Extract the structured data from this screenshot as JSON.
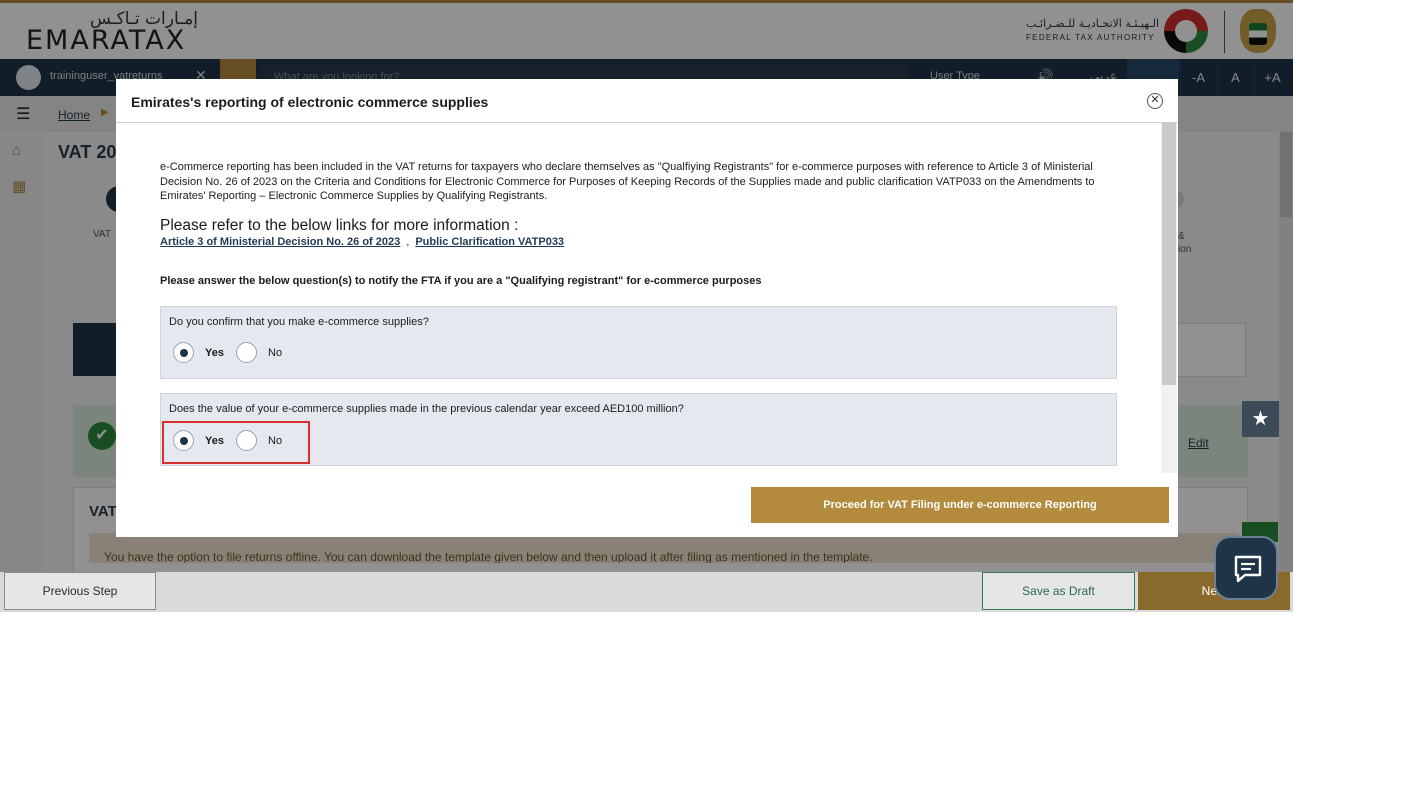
{
  "header": {
    "logo_ar": "إمـارات تـاكـس",
    "logo_en": "EMARATAX",
    "authority_ar": "الـهيـئـة الاتحـاديـة للـضـرائـب",
    "authority_en": "FEDERAL TAX AUTHORITY"
  },
  "navbar": {
    "username": "traininguser_vatreturns",
    "close_symbol": "✕",
    "search_placeholder": "What are you looking for?",
    "user_type": "User Type",
    "sound_symbol": "🔊",
    "language": "عربي",
    "font_small": "-A",
    "font_normal": "A",
    "font_large": "+A"
  },
  "breadcrumb": {
    "home": "Home",
    "arrow": "▶"
  },
  "page": {
    "title": "VAT 20",
    "vat_short": "VAT",
    "vat_section": "VAT",
    "edit": "Edit",
    "info_text": "You have the option to file returns offline. You can download the template given below and then upload it after filing as mentioned in the template.",
    "side_text_1": "&",
    "side_text_2": "ion",
    "check_symbol": "✔",
    "star_symbol": "★"
  },
  "footer": {
    "previous": "Previous Step",
    "draft": "Save as Draft",
    "next": "Next"
  },
  "modal": {
    "title": "Emirates's reporting of electronic commerce supplies",
    "close_symbol": "✕",
    "intro": "e-Commerce reporting has been included in the VAT returns for taxpayers who declare themselves as \"Qualfiying Registrants\" for e-commerce purposes with reference to Article 3 of Ministerial Decision No. 26 of 2023 on the Criteria and Conditions for Electronic Commerce for Purposes of Keeping Records of the Supplies made and public clarification VATP033 on the Amendments to Emirates' Reporting – Electronic Commerce Supplies by Qualifying Registrants.",
    "refer_heading": "Please refer to the below links for more information :",
    "link_1": "Article 3 of Ministerial Decision No. 26 of 2023",
    "link_separator": ",",
    "link_2": "Public Clarification VATP033",
    "question_note": "Please answer the below question(s) to notify the FTA if you are a \"Qualifying registrant\" for e-commerce purposes",
    "questions": [
      {
        "text": "Do you confirm that you make e-commerce supplies?",
        "yes": "Yes",
        "no": "No",
        "selected": "Yes"
      },
      {
        "text": "Does the value of your e-commerce supplies made in the previous calendar year exceed AED100 million?",
        "yes": "Yes",
        "no": "No",
        "selected": "Yes"
      }
    ],
    "proceed": "Proceed for VAT Filing under e-commerce Reporting"
  },
  "colors": {
    "navy": "#1f3447",
    "gold": "#b48a3c",
    "highlight": "#d62f2f"
  },
  "icons": [
    "user-avatar-icon",
    "search-icon",
    "hamburger-menu-icon",
    "home-icon",
    "grid-icon",
    "close-circle-icon",
    "star-icon",
    "chat-icon",
    "speaker-icon",
    "check-icon",
    "edit-icon"
  ]
}
